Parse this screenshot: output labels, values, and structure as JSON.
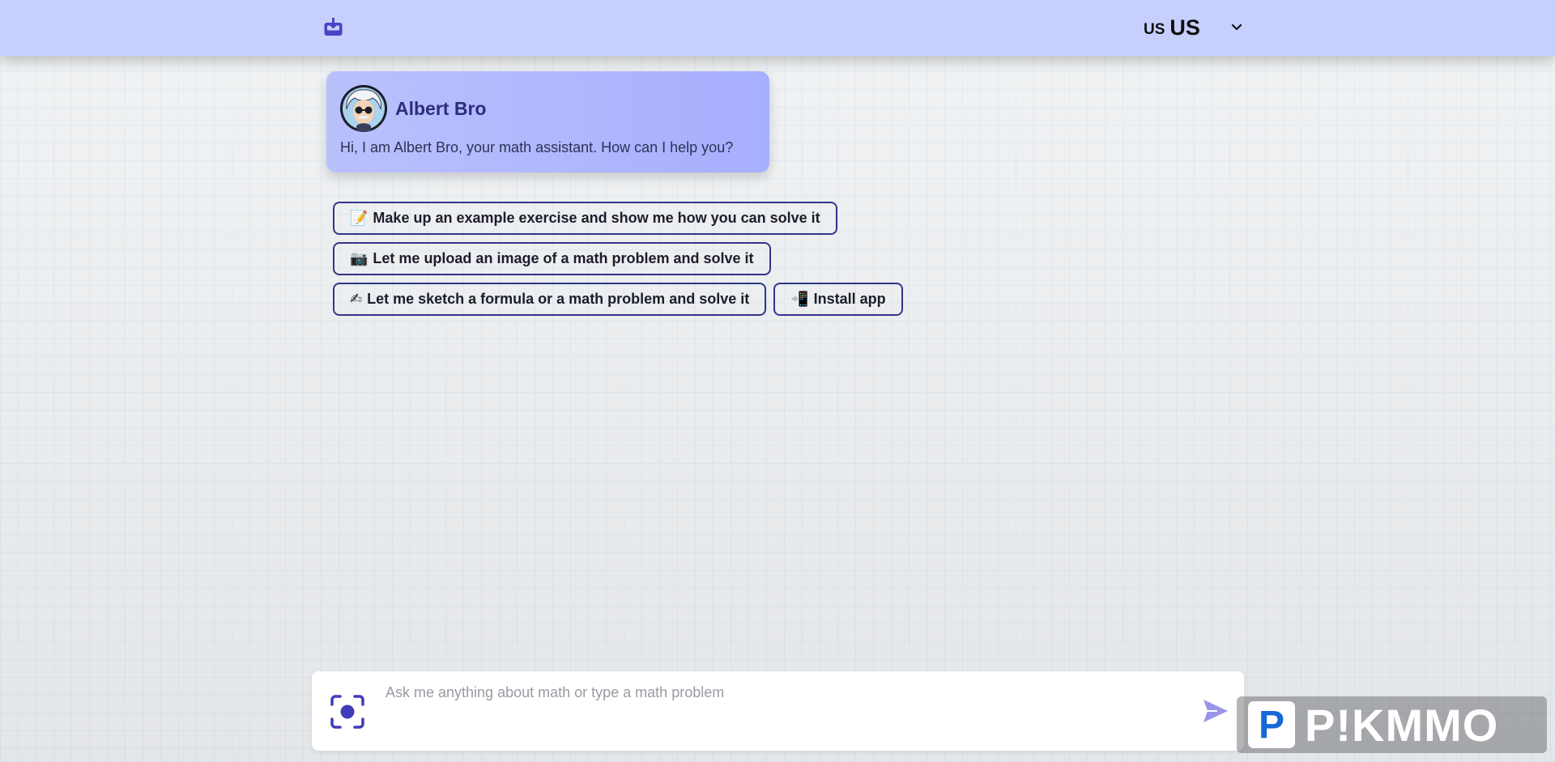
{
  "header": {
    "inbox_icon": "inbox-download-icon",
    "language": {
      "flag_text": "US",
      "code": "US",
      "chevron_icon": "chevron-down-icon"
    }
  },
  "assistant": {
    "name": "Albert Bro",
    "greeting": "Hi, I am Albert Bro, your math assistant. How can I help you?",
    "avatar_icon": "einstein-avatar"
  },
  "suggestions": [
    {
      "emoji": "📝",
      "label": "Make up an example exercise and show me how you can solve it"
    },
    {
      "emoji": "📷",
      "label": "Let me upload an image of a math problem and solve it"
    },
    {
      "emoji": "✍",
      "label": "Let me sketch a formula or a math problem and solve it"
    },
    {
      "emoji": "📲",
      "label": "Install app"
    }
  ],
  "composer": {
    "placeholder": "Ask me anything about math or type a math problem",
    "value": "",
    "camera_icon": "camera-capture-icon",
    "send_icon": "send-icon"
  },
  "watermark": {
    "logo_letter": "P",
    "text": "P!KMMO"
  },
  "colors": {
    "header_bg": "#c7d0fd",
    "accent": "#3f3cbb",
    "chip_border": "#33358a",
    "send": "#9b95ea"
  }
}
